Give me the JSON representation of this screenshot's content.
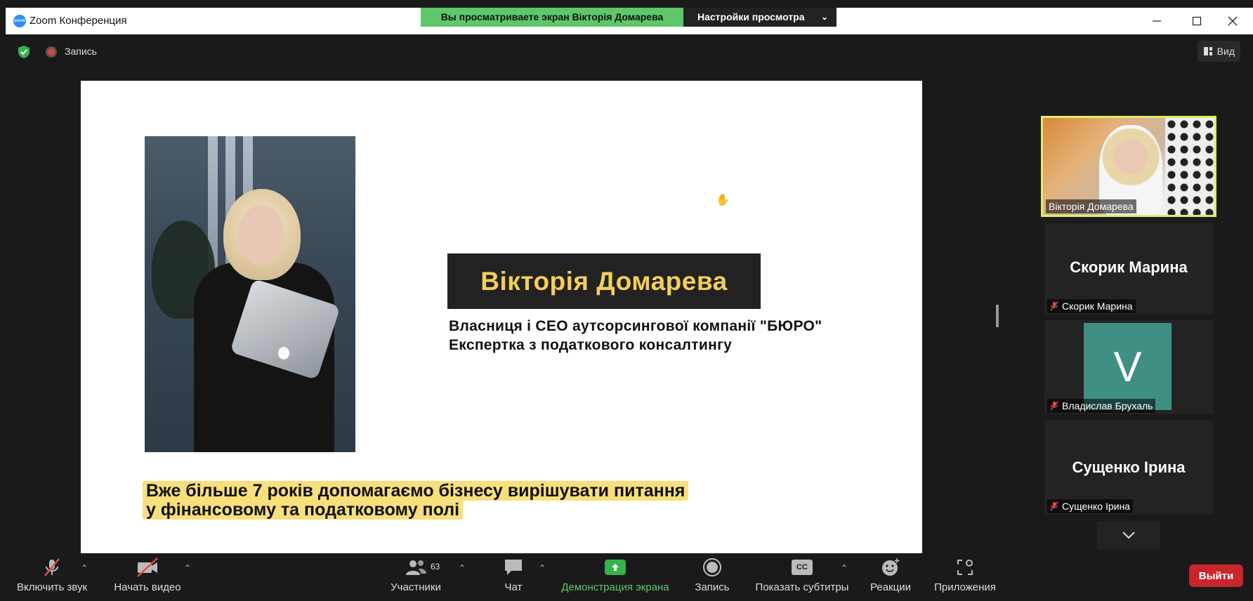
{
  "window": {
    "title": "Zoom Конференция"
  },
  "share_banner": {
    "viewing_text": "Вы просматриваете экран Вікторія Домарева",
    "settings_label": "Настройки просмотра"
  },
  "topbar": {
    "recording_label": "Запись",
    "view_label": "Вид"
  },
  "slide": {
    "name": "Вікторія Домарева",
    "role_line1": "Власниця і CEO аутсорсингової компанії \"БЮРО\"",
    "role_line2": "Експертка з податкового консалтингу",
    "tagline_line1": "Вже більше 7 років допомагаємо бізнесу вирішувати питання",
    "tagline_line2": "у фінансовому та податковому полі"
  },
  "participants": [
    {
      "name": "Вікторія Домарева",
      "has_video": true,
      "active": true
    },
    {
      "name": "Скорик Марина",
      "big_name": "Скорик Марина",
      "muted": true
    },
    {
      "name": "Владислав Брухаль",
      "avatar_letter": "V",
      "muted": true
    },
    {
      "name": "Сущенко Ірина",
      "big_name": "Сущенко Ірина",
      "muted": true
    }
  ],
  "toolbar": {
    "audio_label": "Включить звук",
    "video_label": "Начать видео",
    "participants_label": "Участники",
    "participants_count": "63",
    "chat_label": "Чат",
    "share_label": "Демонстрация экрана",
    "record_label": "Запись",
    "captions_label": "Показать субтитры",
    "captions_badge": "CC",
    "reactions_label": "Реакции",
    "apps_label": "Приложения",
    "exit_label": "Выйти"
  },
  "colors": {
    "accent_green": "#5ec76a",
    "exit_red": "#c7262b",
    "active_border": "#e0ec6b",
    "name_gold": "#f2cf5c",
    "highlight_yellow": "#f7df7b"
  }
}
